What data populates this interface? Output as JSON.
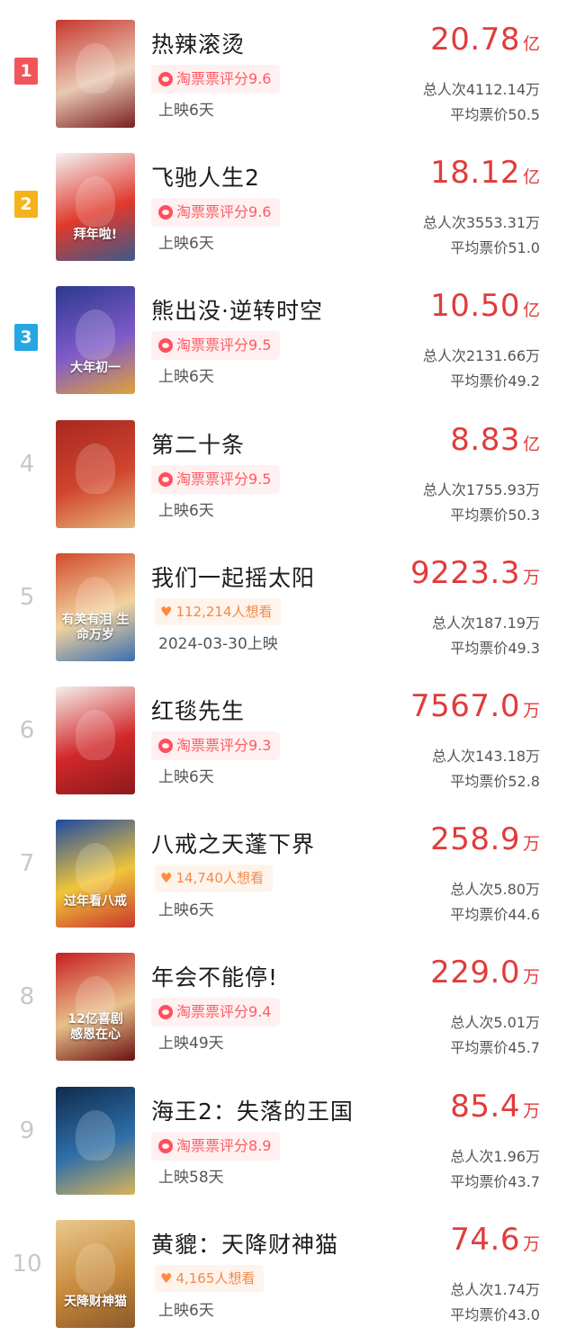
{
  "colors": {
    "accent_red": "#e23b3b",
    "rank1": "#f2545b",
    "rank2": "#f5b31b",
    "rank3": "#25a7e3",
    "rank_plain": "#c7c7c7",
    "score_text": "#ff5a63",
    "want_text": "#f08a4b"
  },
  "icons": {
    "score": "taopiaopiao-logo-icon",
    "want": "heart-icon"
  },
  "movies": [
    {
      "rank": "1",
      "title": "热辣滚烫",
      "rating_label": "淘票票评分",
      "rating": "9.6",
      "want": null,
      "release": "上映6天",
      "box_office": "20.78",
      "unit": "亿",
      "total_admissions_label": "总人次",
      "total_admissions": "4112.14万",
      "avg_price_label": "平均票价",
      "avg_price": "50.5",
      "poster_text": "",
      "poster_colors": [
        "#c7372f",
        "#e8c9b4",
        "#7a1f1f"
      ]
    },
    {
      "rank": "2",
      "title": "飞驰人生2",
      "rating_label": "淘票票评分",
      "rating": "9.6",
      "want": null,
      "release": "上映6天",
      "box_office": "18.12",
      "unit": "亿",
      "total_admissions_label": "总人次",
      "total_admissions": "3553.31万",
      "avg_price_label": "平均票价",
      "avg_price": "51.0",
      "poster_text": "拜年啦!",
      "poster_colors": [
        "#f3f3f3",
        "#e0392b",
        "#3a5a8c"
      ]
    },
    {
      "rank": "3",
      "title": "熊出没·逆转时空",
      "rating_label": "淘票票评分",
      "rating": "9.5",
      "want": null,
      "release": "上映6天",
      "box_office": "10.50",
      "unit": "亿",
      "total_admissions_label": "总人次",
      "total_admissions": "2131.66万",
      "avg_price_label": "平均票价",
      "avg_price": "49.2",
      "poster_text": "大年初一",
      "poster_colors": [
        "#2b3a8f",
        "#7f5ac9",
        "#e0a23b"
      ]
    },
    {
      "rank": "4",
      "title": "第二十条",
      "rating_label": "淘票票评分",
      "rating": "9.5",
      "want": null,
      "release": "上映6天",
      "box_office": "8.83",
      "unit": "亿",
      "total_admissions_label": "总人次",
      "total_admissions": "1755.93万",
      "avg_price_label": "平均票价",
      "avg_price": "50.3",
      "poster_text": "",
      "poster_colors": [
        "#a8281f",
        "#d0452f",
        "#e6b77a"
      ]
    },
    {
      "rank": "5",
      "title": "我们一起摇太阳",
      "rating_label": "",
      "rating": "",
      "want": "112,214人想看",
      "release": "2024-03-30上映",
      "box_office": "9223.3",
      "unit": "万",
      "total_admissions_label": "总人次",
      "total_admissions": "187.19万",
      "avg_price_label": "平均票价",
      "avg_price": "49.3",
      "poster_text": "有笑有泪 生命万岁",
      "poster_colors": [
        "#d24b2c",
        "#f2d3a0",
        "#3a6fb0"
      ]
    },
    {
      "rank": "6",
      "title": "红毯先生",
      "rating_label": "淘票票评分",
      "rating": "9.3",
      "want": null,
      "release": "上映6天",
      "box_office": "7567.0",
      "unit": "万",
      "total_admissions_label": "总人次",
      "total_admissions": "143.18万",
      "avg_price_label": "平均票价",
      "avg_price": "52.8",
      "poster_text": "",
      "poster_colors": [
        "#f4f1ec",
        "#d2282a",
        "#8c1a1c"
      ]
    },
    {
      "rank": "7",
      "title": "八戒之天蓬下界",
      "rating_label": "",
      "rating": "",
      "want": "14,740人想看",
      "release": "上映6天",
      "box_office": "258.9",
      "unit": "万",
      "total_admissions_label": "总人次",
      "total_admissions": "5.80万",
      "avg_price_label": "平均票价",
      "avg_price": "44.6",
      "poster_text": "过年看八戒",
      "poster_colors": [
        "#1e4aa3",
        "#f0c53a",
        "#c9362c"
      ]
    },
    {
      "rank": "8",
      "title": "年会不能停!",
      "rating_label": "淘票票评分",
      "rating": "9.4",
      "want": null,
      "release": "上映49天",
      "box_office": "229.0",
      "unit": "万",
      "total_admissions_label": "总人次",
      "total_admissions": "5.01万",
      "avg_price_label": "平均票价",
      "avg_price": "45.7",
      "poster_text": "12亿喜剧 感恩在心",
      "poster_colors": [
        "#c81f22",
        "#e8c08a",
        "#6b1010"
      ]
    },
    {
      "rank": "9",
      "title": "海王2：失落的王国",
      "rating_label": "淘票票评分",
      "rating": "8.9",
      "want": null,
      "release": "上映58天",
      "box_office": "85.4",
      "unit": "万",
      "total_admissions_label": "总人次",
      "total_admissions": "1.96万",
      "avg_price_label": "平均票价",
      "avg_price": "43.7",
      "poster_text": "",
      "poster_colors": [
        "#0f2b4d",
        "#2f6fa8",
        "#d8b35a"
      ]
    },
    {
      "rank": "10",
      "title": "黄貔：天降财神猫",
      "rating_label": "",
      "rating": "",
      "want": "4,165人想看",
      "release": "上映6天",
      "box_office": "74.6",
      "unit": "万",
      "total_admissions_label": "总人次",
      "total_admissions": "1.74万",
      "avg_price_label": "平均票价",
      "avg_price": "43.0",
      "poster_text": "天降财神猫",
      "poster_colors": [
        "#e9c98e",
        "#c98a3c",
        "#8a5a2a"
      ]
    }
  ]
}
